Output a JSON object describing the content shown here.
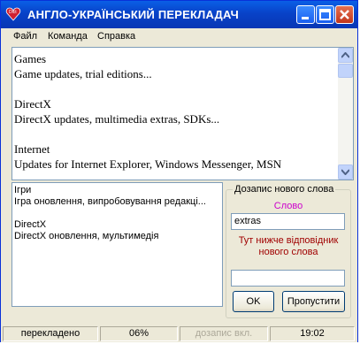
{
  "window": {
    "title": "АНГЛО-УКРАЇНСЬКИЙ ПЕРЕКЛАДАЧ"
  },
  "menu": {
    "items": [
      "Файл",
      "Команда",
      "Справка"
    ]
  },
  "source_text": {
    "lines": [
      "Games",
      "Game updates, trial editions...",
      "",
      "DirectX",
      "DirectX updates, multimedia extras, SDKs...",
      "",
      "Internet",
      "Updates for Internet Explorer, Windows Messenger, MSN"
    ]
  },
  "translation_text": {
    "lines": [
      "Ігри",
      "Ігра оновлення, випробовування редакці...",
      "",
      "DirectX",
      "DirectX оновлення, мультимедія"
    ]
  },
  "add_word": {
    "group_label": "Дозапис нового слова",
    "word_label": "Слово",
    "word_value": "extras",
    "prompt": "Тут нижче відповідник нового слова",
    "answer_value": "",
    "ok_label": "OK",
    "skip_label": "Пропустити"
  },
  "status": {
    "state": "перекладено",
    "progress": "06%",
    "add_mode": "дозапис вкл.",
    "time": "19:02"
  },
  "colors": {
    "title_bar": "#0842c8",
    "word_label": "#cc00cc",
    "prompt": "#a00000"
  }
}
